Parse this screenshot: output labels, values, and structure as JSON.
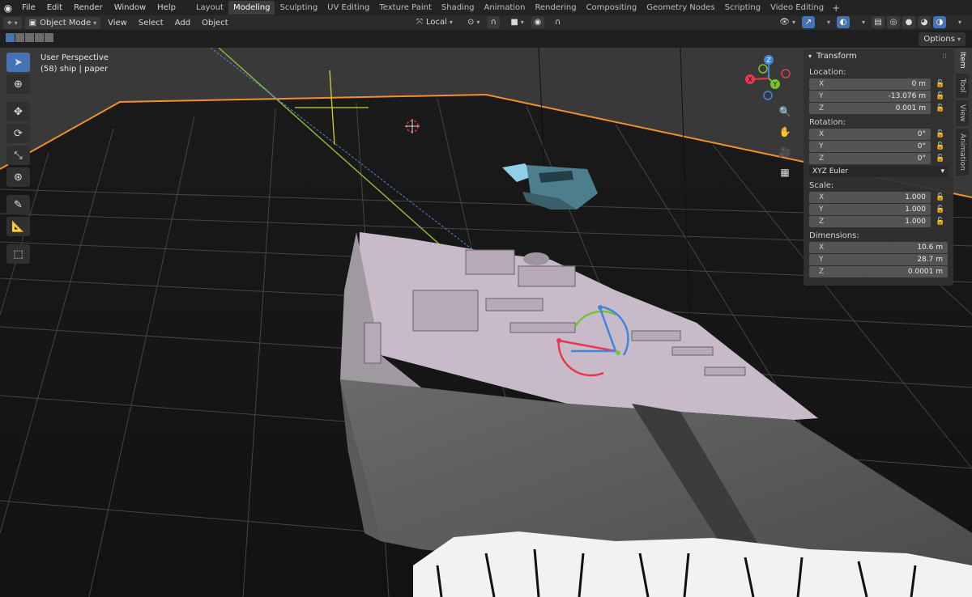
{
  "menu": {
    "items": [
      "File",
      "Edit",
      "Render",
      "Window",
      "Help"
    ]
  },
  "workspaces": {
    "tabs": [
      "Layout",
      "Modeling",
      "Sculpting",
      "UV Editing",
      "Texture Paint",
      "Shading",
      "Animation",
      "Rendering",
      "Compositing",
      "Geometry Nodes",
      "Scripting",
      "Video Editing"
    ],
    "active": "Modeling",
    "add": "+"
  },
  "header": {
    "mode": "Object Mode",
    "menus": [
      "View",
      "Select",
      "Add",
      "Object"
    ],
    "orientation": "Local"
  },
  "subbar": {
    "options": "Options"
  },
  "viewport": {
    "view_name": "User Perspective",
    "object_info": "(58) ship | paper"
  },
  "gizmo": {
    "x": "X",
    "y": "Y",
    "z": "Z",
    "colors": {
      "x": "#e8374f",
      "y": "#7bc22f",
      "z": "#3f86e0"
    }
  },
  "npanel": {
    "title": "Transform",
    "location_label": "Location:",
    "location": [
      {
        "axis": "X",
        "value": "0 m"
      },
      {
        "axis": "Y",
        "value": "-13.076 m"
      },
      {
        "axis": "Z",
        "value": "0.001 m"
      }
    ],
    "rotation_label": "Rotation:",
    "rotation": [
      {
        "axis": "X",
        "value": "0°"
      },
      {
        "axis": "Y",
        "value": "0°"
      },
      {
        "axis": "Z",
        "value": "0°"
      }
    ],
    "rotation_mode": "XYZ Euler",
    "scale_label": "Scale:",
    "scale": [
      {
        "axis": "X",
        "value": "1.000"
      },
      {
        "axis": "Y",
        "value": "1.000"
      },
      {
        "axis": "Z",
        "value": "1.000"
      }
    ],
    "dimensions_label": "Dimensions:",
    "dimensions": [
      {
        "axis": "X",
        "value": "10.6 m"
      },
      {
        "axis": "Y",
        "value": "28.7 m"
      },
      {
        "axis": "Z",
        "value": "0.0001 m"
      }
    ]
  },
  "sidetabs": [
    "Item",
    "Tool",
    "View",
    "Animation"
  ],
  "colors": {
    "accent": "#4772b3",
    "selection_outline": "#f0902a"
  }
}
